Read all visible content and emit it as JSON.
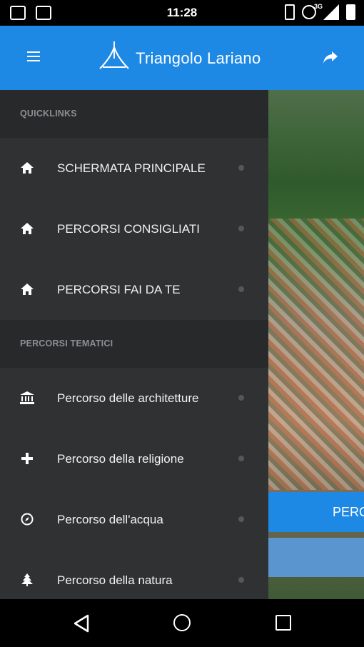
{
  "status_bar": {
    "time": "11:28",
    "network": "3G",
    "icons": [
      "notification-icon",
      "image-icon",
      "vibrate-icon",
      "alarm-icon",
      "signal-icon",
      "battery-icon"
    ]
  },
  "app_bar": {
    "title": "Triangolo Lariano",
    "menu_icon": "hamburger-icon",
    "share_icon": "share-icon",
    "color": "#1e88e5"
  },
  "drawer": {
    "sections": [
      {
        "header": "QUICKLINKS",
        "items": [
          {
            "label": "SCHERMATA PRINCIPALE",
            "icon": "home-icon"
          },
          {
            "label": "PERCORSI CONSIGLIATI",
            "icon": "home-icon"
          },
          {
            "label": "PERCORSI FAI DA TE",
            "icon": "home-icon"
          }
        ]
      },
      {
        "header": "PERCORSI TEMATICI",
        "items": [
          {
            "label": "Percorso delle architetture",
            "icon": "bank-icon"
          },
          {
            "label": "Percorso della religione",
            "icon": "plus-icon"
          },
          {
            "label": "Percorso dell'acqua",
            "icon": "compass-icon"
          },
          {
            "label": "Percorso della natura",
            "icon": "tree-icon"
          }
        ]
      }
    ]
  },
  "background": {
    "button_label": "PERC"
  },
  "nav_bar": {
    "icons": [
      "back-icon",
      "home-circle-icon",
      "recent-apps-icon"
    ]
  }
}
